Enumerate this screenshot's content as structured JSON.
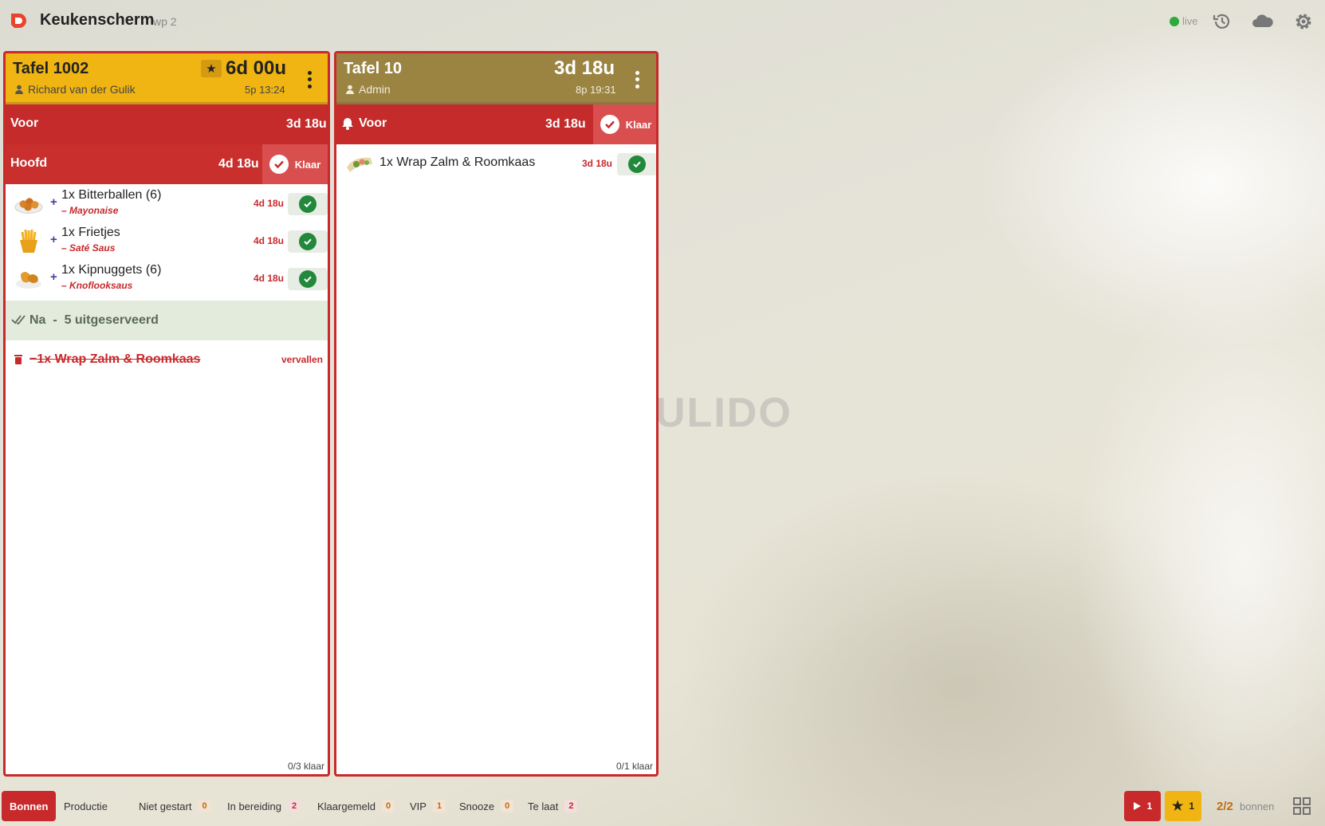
{
  "header": {
    "app_title": "Keukenscherm",
    "workplace": "wp 2",
    "status_label": "live",
    "icons": [
      "history-icon",
      "cloud-icon",
      "gear-icon"
    ]
  },
  "watermark": "ULIDO",
  "cards": [
    {
      "table": "Tafel 1002",
      "user": "Richard van der Gulik",
      "elapsed": "6d 00u",
      "guests_time": "5p 13:24",
      "header_color": "#f0b512",
      "vip": true,
      "courses": [
        {
          "name": "Voor",
          "time": "3d 18u"
        },
        {
          "name": "Hoofd",
          "time": "4d 18u",
          "action": "Klaar"
        }
      ],
      "items": [
        {
          "name": "1x Bitterballen (6)",
          "modifier": "– Mayonaise",
          "time": "4d 18u",
          "icon": "bitterballen-icon"
        },
        {
          "name": "1x Frietjes",
          "modifier": "– Saté Saus",
          "time": "4d 18u",
          "icon": "fries-icon"
        },
        {
          "name": "1x Kipnuggets (6)",
          "modifier": "– Knoflooksaus",
          "time": "4d 18u",
          "icon": "nuggets-icon"
        }
      ],
      "served_course": "Na",
      "served_text": "5 uitgeserveerd",
      "voided_item": "−1x Wrap Zalm & Roomkaas",
      "voided_status": "vervallen",
      "footer": "0/3 klaar"
    },
    {
      "table": "Tafel 10",
      "user": "Admin",
      "elapsed": "3d 18u",
      "guests_time": "8p 19:31",
      "header_color": "#9b8442",
      "vip": false,
      "courses": [
        {
          "name": "Voor",
          "time": "3d 18u",
          "action": "Klaar",
          "bell": true
        }
      ],
      "items": [
        {
          "name": "1x Wrap Zalm & Roomkaas",
          "time": "3d 18u",
          "icon": "wrap-icon"
        }
      ],
      "footer": "0/1 klaar"
    }
  ],
  "bottombar": {
    "tabs": [
      {
        "label": "Bonnen",
        "active": true
      },
      {
        "label": "Productie"
      }
    ],
    "filters": [
      {
        "label": "Niet gestart",
        "count": "0"
      },
      {
        "label": "In bereiding",
        "count": "2"
      },
      {
        "label": "Klaargemeld",
        "count": "0"
      },
      {
        "label": "VIP",
        "count": "1"
      },
      {
        "label": "Snooze",
        "count": "0"
      },
      {
        "label": "Te laat",
        "count": "2"
      }
    ],
    "play_count": "1",
    "star_count": "1",
    "bon_count": "2/2",
    "bon_label": "bonnen"
  },
  "colors": {
    "accent_red": "#c8292b",
    "vip_yellow": "#f0b512",
    "card2_header": "#9b8442",
    "done_green": "#22883b"
  }
}
